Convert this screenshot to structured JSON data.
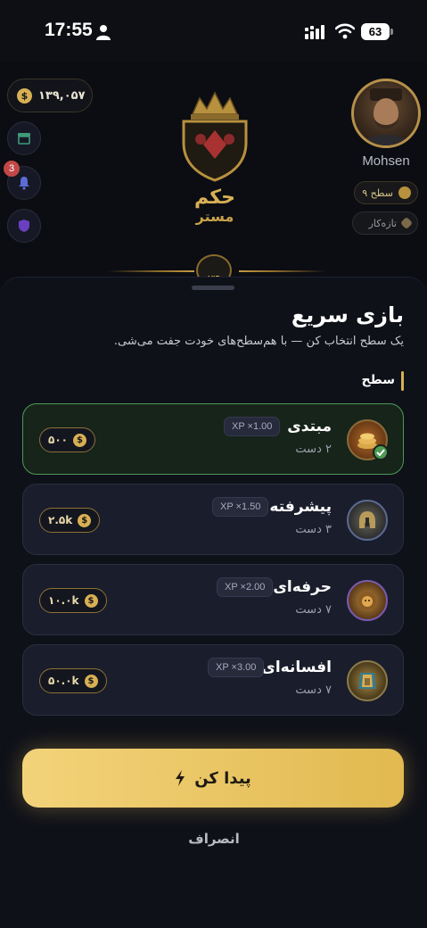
{
  "status_bar": {
    "time": "17:55",
    "battery": "63"
  },
  "header": {
    "coins": "۱۳۹,۰۵۷",
    "notification_count": "3",
    "logo_text": "حکم مستر",
    "logo_badge": "VIP",
    "username": "Mohsen",
    "level_label": "سطح ۹",
    "rank_label": "تازه‌کار"
  },
  "sheet": {
    "title": "بازی سریع",
    "subtitle": "یک سطح انتخاب کن — با هم‌سطح‌های خودت جفت می‌شی.",
    "section_label": "سطح",
    "tiers": [
      {
        "name": "مبتدی",
        "hands": "۲ دست",
        "xp": "XP ×1.00",
        "price": "۵۰۰",
        "selected": true,
        "icon": "coin-stack-icon"
      },
      {
        "name": "پیشرفته",
        "hands": "۳ دست",
        "xp": "XP ×1.50",
        "price": "۲.۵k",
        "selected": false,
        "icon": "helmet-icon"
      },
      {
        "name": "حرفه‌ای",
        "hands": "۷ دست",
        "xp": "XP ×2.00",
        "price": "۱۰.۰k",
        "selected": false,
        "icon": "lion-icon"
      },
      {
        "name": "افسانه‌ای",
        "hands": "۷ دست",
        "xp": "XP ×3.00",
        "price": "۵۰.۰k",
        "selected": false,
        "icon": "pharaoh-icon"
      }
    ],
    "find_button": "پیدا کن",
    "cancel_button": "انصراف"
  }
}
